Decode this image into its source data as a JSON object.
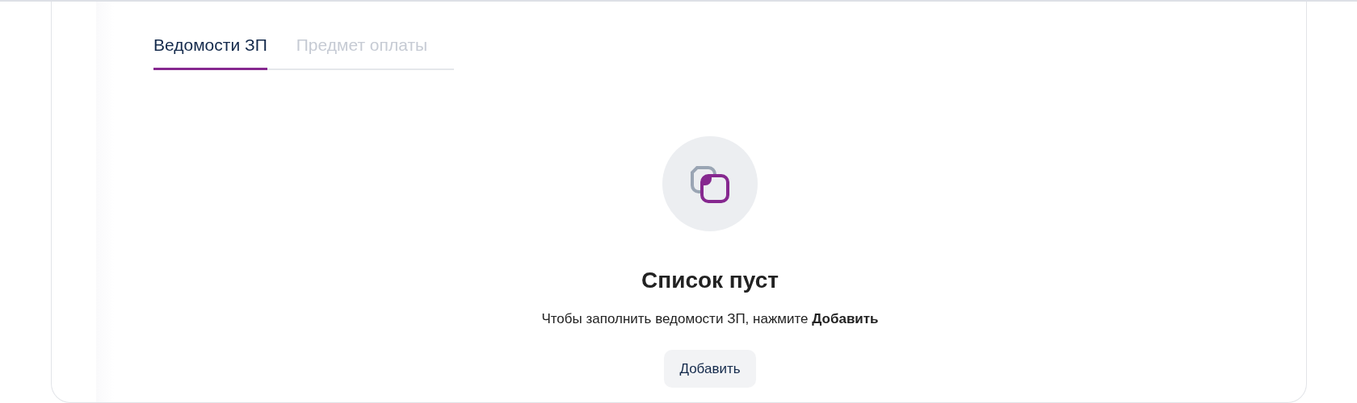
{
  "tabs": [
    {
      "label": "Ведомости ЗП",
      "selected": true
    },
    {
      "label": "Предмет оплаты",
      "selected": false
    }
  ],
  "empty_state": {
    "title": "Список пуст",
    "message": "Чтобы заполнить ведомости ЗП, нажмите **Добавить**",
    "button": "Добавить"
  }
}
